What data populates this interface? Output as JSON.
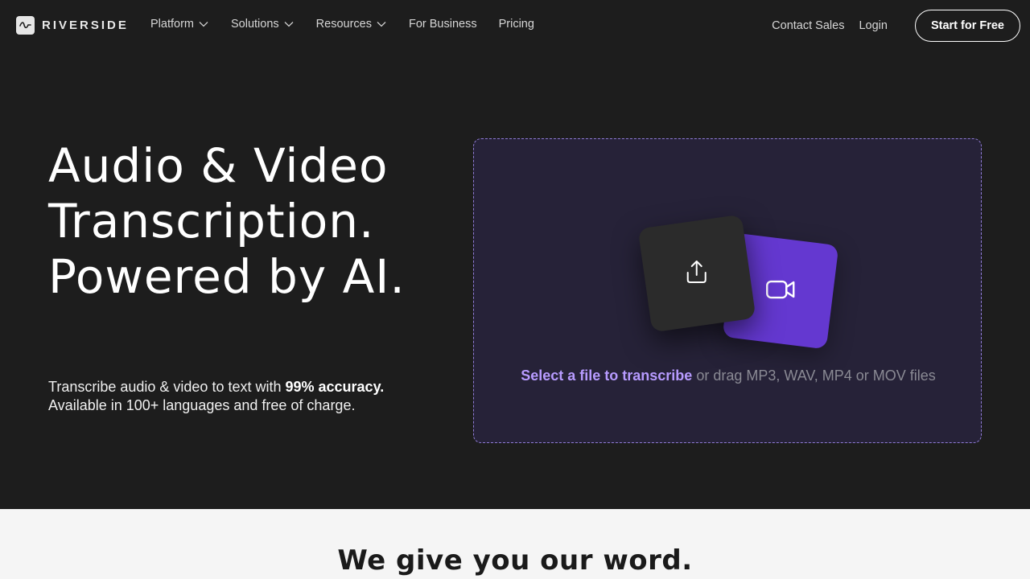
{
  "brand": {
    "name": "RIVERSIDE",
    "logo_icon": "waveform-icon"
  },
  "nav": {
    "links": [
      {
        "label": "Platform",
        "has_dropdown": true
      },
      {
        "label": "Solutions",
        "has_dropdown": true
      },
      {
        "label": "Resources",
        "has_dropdown": true
      },
      {
        "label": "For Business",
        "has_dropdown": false
      },
      {
        "label": "Pricing",
        "has_dropdown": false
      }
    ],
    "contact_sales": "Contact Sales",
    "login": "Login",
    "cta": "Start for Free"
  },
  "hero": {
    "title": "Audio & Video Transcription. Powered by AI.",
    "subtitle_prefix": "Transcribe audio & video to text with ",
    "subtitle_bold": "99% accuracy.",
    "subtitle_line2": "Available in 100+ languages and free of charge."
  },
  "dropzone": {
    "link_text": "Select a file to transcribe",
    "hint_text": " or drag MP3, WAV, MP4 or MOV files",
    "upload_icon": "upload-icon",
    "video_icon": "video-camera-icon"
  },
  "section": {
    "title": "We give you our word."
  },
  "colors": {
    "background": "#1d1d1d",
    "accent_purple": "#6438d0",
    "link_purple": "#b79bff",
    "dropzone_bg": "#262238",
    "light_section": "#f5f5f5"
  }
}
